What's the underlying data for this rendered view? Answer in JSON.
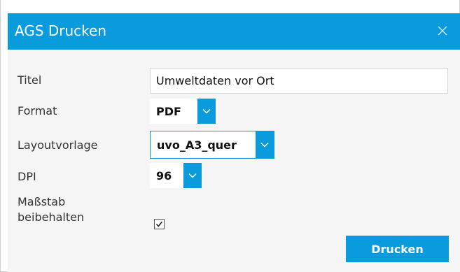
{
  "dialog": {
    "title": "AGS Drucken",
    "close_icon": "close-icon",
    "accent_color": "#0a9bdc"
  },
  "form": {
    "title_label": "Titel",
    "title_value": "Umweltdaten vor Ort",
    "format_label": "Format",
    "format_value": "PDF",
    "layout_label": "Layoutvorlage",
    "layout_value": "uvo_A3_quer",
    "dpi_label": "DPI",
    "dpi_value": "96",
    "scale_label_line1": "Maßstab",
    "scale_label_line2": "beibehalten",
    "scale_checked": true
  },
  "actions": {
    "print_label": "Drucken"
  }
}
